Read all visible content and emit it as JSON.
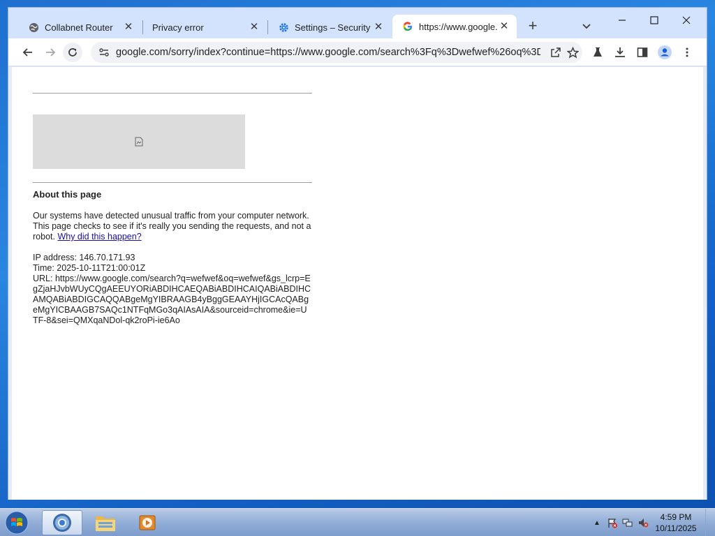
{
  "browser": {
    "tabs": [
      {
        "label": "Collabnet Router",
        "icon": "globe-icon"
      },
      {
        "label": "Privacy error",
        "icon": "none"
      },
      {
        "label": "Settings – Security",
        "icon": "gear-icon"
      },
      {
        "label": "https://www.google.",
        "icon": "google-icon",
        "active": true
      }
    ],
    "new_tab": "+",
    "url": "google.com/sorry/index?continue=https://www.google.com/search%3Fq%3Dwefwef%26oq%3Dw..."
  },
  "page": {
    "heading": "About this page",
    "message": "Our systems have detected unusual traffic from your computer network. This page checks to see if it's really you sending the requests, and not a robot.",
    "link_text": "Why did this happen?",
    "ip_line": "IP address: 146.70.171.93",
    "time_line": "Time: 2025-10-11T21:00:01Z",
    "url_line": "URL: https://www.google.com/search?q=wefwef&oq=wefwef&gs_lcrp=EgZjaHJvbWUyCQgAEEUYORiABDIHCAEQABiABDIHCAIQABiABDIHCAMQABiABDIGCAQQABgeMgYIBRAAGB4yBggGEAAYHjIGCAcQABgeMgYICBAAGB7SAQc1NTFqMGo3qAIAsAIA&sourceid=chrome&ie=UTF-8&sei=QMXqaNDol-qk2roPi-ie6Ao"
  },
  "taskbar": {
    "time": "4:59 PM",
    "date": "10/11/2025"
  },
  "colors": {
    "tabstrip": "#d3e3fd",
    "link": "#1a0dab",
    "captcha_placeholder": "#dcdcdc"
  }
}
